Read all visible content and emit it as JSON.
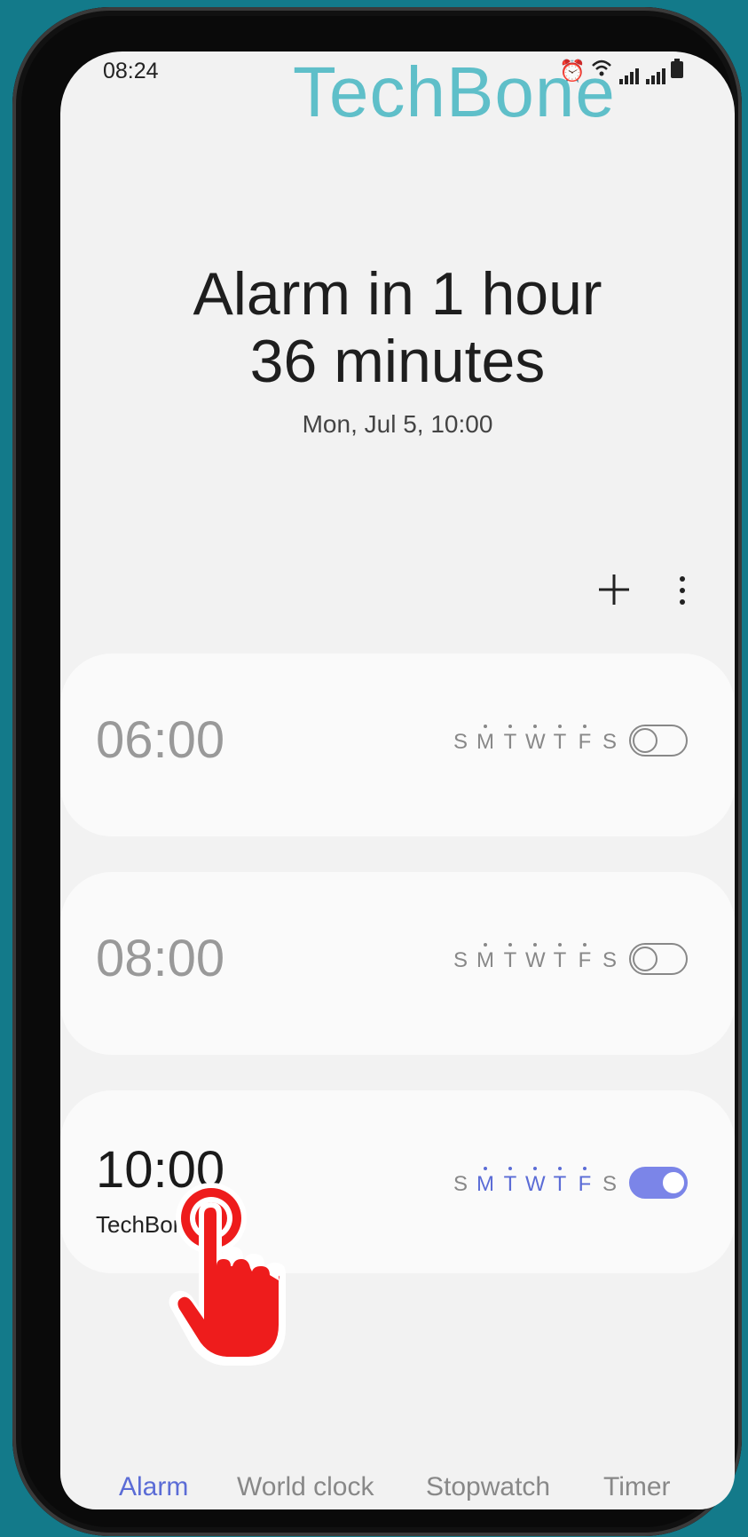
{
  "status": {
    "time": "08:24"
  },
  "watermark": "TechBone",
  "header": {
    "headline_line1": "Alarm in 1 hour",
    "headline_line2": "36 minutes",
    "next_alarm": "Mon, Jul 5, 10:00"
  },
  "days_letters": [
    "S",
    "M",
    "T",
    "W",
    "T",
    "F",
    "S"
  ],
  "alarms": [
    {
      "time": "06:00",
      "label": "",
      "enabled": false,
      "days": [
        false,
        true,
        true,
        true,
        true,
        true,
        false
      ]
    },
    {
      "time": "08:00",
      "label": "",
      "enabled": false,
      "days": [
        false,
        true,
        true,
        true,
        true,
        true,
        false
      ]
    },
    {
      "time": "10:00",
      "label": "TechBone",
      "enabled": true,
      "days": [
        false,
        true,
        true,
        true,
        true,
        true,
        false
      ]
    }
  ],
  "tabs": [
    {
      "label": "Alarm",
      "active": true
    },
    {
      "label": "World clock",
      "active": false
    },
    {
      "label": "Stopwatch",
      "active": false
    },
    {
      "label": "Timer",
      "active": false
    }
  ],
  "colors": {
    "accent": "#5b6cd6",
    "toggle_on": "#7b85e8",
    "background": "#137a8a",
    "hand": "#ee1c1c"
  },
  "icons": [
    "alarm-icon",
    "wifi-icon",
    "signal-icon",
    "battery-icon",
    "plus-icon",
    "more-vertical-icon",
    "tap-hand-icon"
  ]
}
